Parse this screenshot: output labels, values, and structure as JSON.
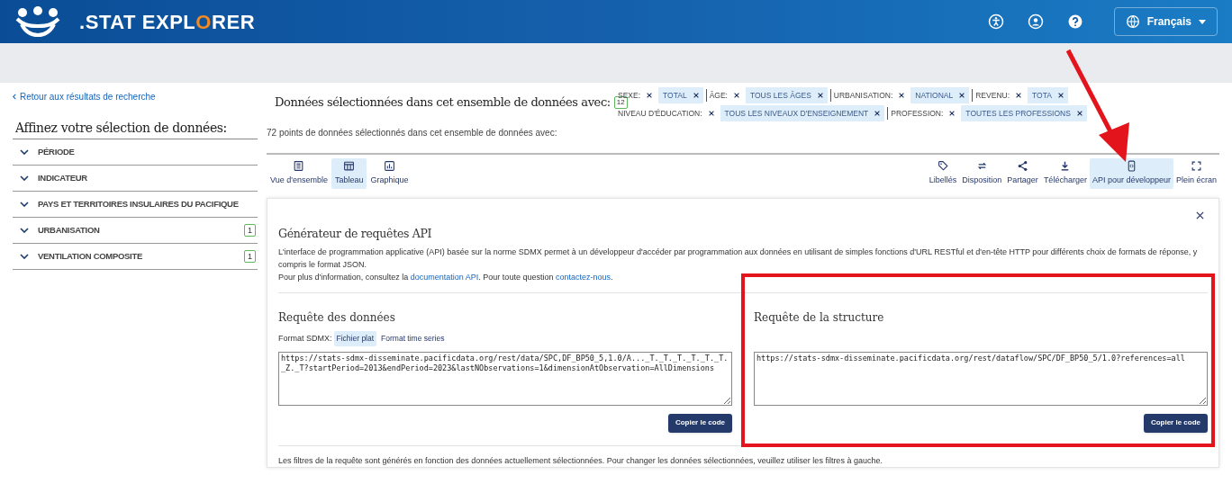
{
  "header": {
    "logo_text": ".STAT EXPL",
    "logo_o": "O",
    "logo_rest": "RER",
    "language": "Français"
  },
  "back_link": "Retour aux résultats de recherche",
  "sidebar": {
    "title": "Affinez votre sélection de données:",
    "items": [
      {
        "label": "PÉRIODE"
      },
      {
        "label": "INDICATEUR"
      },
      {
        "label": "PAYS ET TERRITOIRES INSULAIRES DU PACIFIQUE"
      },
      {
        "label": "URBANISATION",
        "count": "1"
      },
      {
        "label": "VENTILATION COMPOSITE",
        "count": "1"
      }
    ]
  },
  "selection": {
    "title": "Données sélectionnées dans cet ensemble de données avec:",
    "count": "12",
    "points": "72 points de données sélectionnés dans cet ensemble de données avec:",
    "rows": [
      {
        "filters": [
          {
            "label": "SEXE:",
            "value": "TOTAL"
          },
          {
            "label": "ÂGE:",
            "value": "TOUS LES ÂGES"
          },
          {
            "label": "URBANISATION:",
            "value": "NATIONAL"
          },
          {
            "label": "REVENU:",
            "value": "TOTA"
          }
        ]
      },
      {
        "filters": [
          {
            "label": "NIVEAU D'ÉDUCATION:",
            "value": "TOUS LES NIVEAUX D'ENSEIGNEMENT"
          },
          {
            "label": "PROFESSION:",
            "value": "TOUTES LES PROFESSIONS"
          }
        ]
      }
    ]
  },
  "views": [
    {
      "label": "Vue d'ensemble",
      "selected": false
    },
    {
      "label": "Tableau",
      "selected": true
    },
    {
      "label": "Graphique",
      "selected": false
    }
  ],
  "actions": [
    {
      "label": "Libellés",
      "selected": false
    },
    {
      "label": "Disposition",
      "selected": false
    },
    {
      "label": "Partager",
      "selected": false
    },
    {
      "label": "Télécharger",
      "selected": false
    },
    {
      "label": "API pour développeur",
      "selected": true
    },
    {
      "label": "Plein écran",
      "selected": false
    }
  ],
  "api_panel": {
    "title": "Générateur de requêtes API",
    "description": "L'interface de programmation applicative (API) basée sur la norme SDMX permet à un développeur d'accéder par programmation aux données en utilisant de simples fonctions d'URL RESTful et d'en-tête HTTP pour différents choix de formats de réponse, y compris le format JSON.",
    "info_prefix": "Pour plus d'information, consultez la",
    "doc_link": "documentation API",
    "info_mid": ". Pour toute question",
    "contact_link": "contactez-nous",
    "info_end": ".",
    "data_query": {
      "title": "Requête des données",
      "format_label": "Format SDMX:",
      "formats": [
        {
          "label": "Fichier plat",
          "selected": true
        },
        {
          "label": "Format time series",
          "selected": false
        }
      ],
      "url": "https://stats-sdmx-disseminate.pacificdata.org/rest/data/SPC,DF_BP50_5,1.0/A..._T._T._T._T._T._T._Z._T?startPeriod=2013&endPeriod=2023&lastNObservations=1&dimensionAtObservation=AllDimensions",
      "button": "Copier le code"
    },
    "structure_query": {
      "title": "Requête de la structure",
      "url": "https://stats-sdmx-disseminate.pacificdata.org/rest/dataflow/SPC/DF_BP50_5/1.0?references=all",
      "button": "Copier le code",
      "highlighted": true
    },
    "footer": "Les filtres de la requête sont générés en fonction des données actuellement sélectionnées. Pour changer les données sélectionnées, veuillez utiliser les filtres à gauche."
  }
}
